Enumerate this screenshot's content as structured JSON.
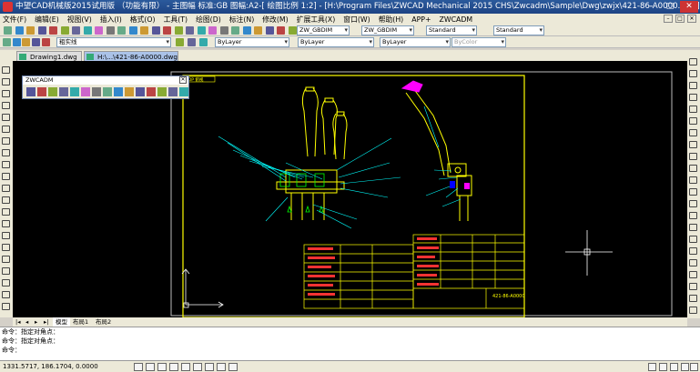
{
  "window": {
    "title": "中望CAD机械版2015试用版 （功能有限） - 主图幅 标准:GB 图幅:A2-[ 绘图比例 1:2] - [H:\\Program Files\\ZWCAD Mechanical 2015 CHS\\Zwcadm\\Sample\\Dwg\\zwjx\\421-86-A0000.dwg]"
  },
  "menu": [
    "文件(F)",
    "编辑(E)",
    "视图(V)",
    "插入(I)",
    "格式(O)",
    "工具(T)",
    "绘图(D)",
    "标注(N)",
    "修改(M)",
    "扩展工具(X)",
    "窗口(W)",
    "帮助(H)",
    "APP+",
    "ZWCADM"
  ],
  "toolbar1": {
    "dim_style": "ZW_GBDIM",
    "dim_style2": "ZW_GBDIM",
    "text_style": "Standard",
    "table_style": "Standard"
  },
  "toolbar2": {
    "layer": "粗实线",
    "color": "ByLayer",
    "linetype": "ByLayer",
    "lineweight": "ByLayer",
    "plotstyle": "ByColor"
  },
  "tabs": [
    {
      "label": "Drawing1.dwg"
    },
    {
      "label": "H:\\...\\421-86-A0000.dwg"
    }
  ],
  "palette": {
    "title": "ZWCADM"
  },
  "drawing": {
    "title_block_text": "421-86-A0000",
    "frame_label": "TOP 俯视"
  },
  "model_tabs": [
    "模型",
    "布局1",
    "布局2"
  ],
  "command": {
    "lines": [
      "命令：指定对角点：",
      "命令：指定对角点：",
      "命令："
    ]
  },
  "status": {
    "coords": "1331.5717,  186.1704,  0.0000"
  }
}
